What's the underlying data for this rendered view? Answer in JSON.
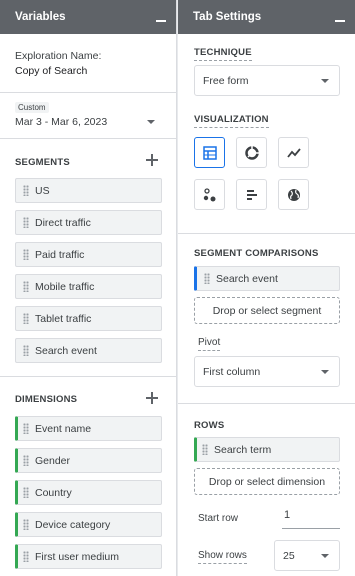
{
  "variables": {
    "header": "Variables",
    "exploration_name_label": "Exploration Name:",
    "exploration_name_value": "Copy of Search",
    "date_range_tag": "Custom",
    "date_range_value": "Mar 3 - Mar 6, 2023",
    "segments_title": "SEGMENTS",
    "segments": [
      "US",
      "Direct traffic",
      "Paid traffic",
      "Mobile traffic",
      "Tablet traffic",
      "Search event"
    ],
    "dimensions_title": "DIMENSIONS",
    "dimensions": [
      "Event name",
      "Gender",
      "Country",
      "Device category",
      "First user medium"
    ]
  },
  "tab_settings": {
    "header": "Tab Settings",
    "technique_title": "TECHNIQUE",
    "technique_value": "Free form",
    "visualization_title": "VISUALIZATION",
    "visualization_icons": [
      "table-icon",
      "donut-chart-icon",
      "line-chart-icon",
      "scatter-plot-icon",
      "bar-chart-icon",
      "geo-map-icon"
    ],
    "segment_comparisons_title": "SEGMENT COMPARISONS",
    "segment_comparison_item": "Search event",
    "drop_segment_label": "Drop or select segment",
    "pivot_label": "Pivot",
    "pivot_value": "First column",
    "rows_title": "ROWS",
    "rows_item": "Search term",
    "drop_dimension_label": "Drop or select dimension",
    "start_row_label": "Start row",
    "start_row_value": "1",
    "show_rows_label": "Show rows",
    "show_rows_value": "25"
  },
  "colors": {
    "header_bg": "#5f6368",
    "accent_blue": "#1a73e8",
    "dimension_green": "#34a853"
  }
}
